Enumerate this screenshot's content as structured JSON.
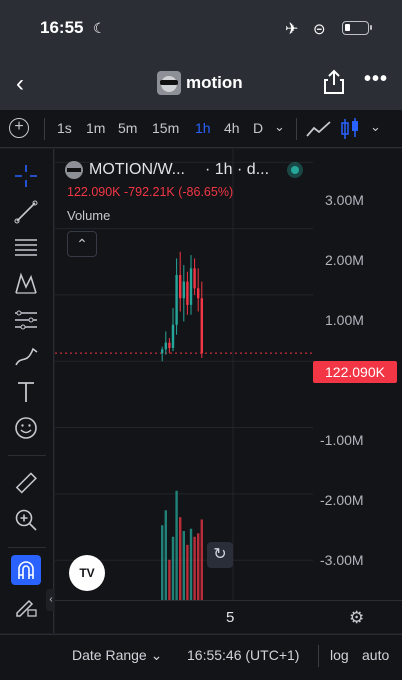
{
  "status": {
    "time": "16:55"
  },
  "nav": {
    "title": "motion"
  },
  "intervals": [
    "1s",
    "1m",
    "5m",
    "15m",
    "1h",
    "4h",
    "D"
  ],
  "active_interval": "1h",
  "legend": {
    "symbol": "MOTION/W...",
    "timeframe": "· 1h · d...",
    "price": "122.090K",
    "change": "-792.21K",
    "change_pct": "(-86.65%)",
    "volume_label": "Volume"
  },
  "price_axis": [
    "3.00M",
    "2.00M",
    "1.00M",
    "-1.00M",
    "-2.00M",
    "-3.00M"
  ],
  "price_tag": "122.090K",
  "time_axis": [
    "5"
  ],
  "bottom": {
    "date_range": "Date Range",
    "clock": "16:55:46 (UTC+1)",
    "log": "log",
    "auto": "auto"
  },
  "colors": {
    "up": "#26a69a",
    "down": "#f23645",
    "accent": "#2962ff",
    "bg": "#131417"
  },
  "chart_data": {
    "type": "bar",
    "y_range_millions": [
      -3.6,
      3.2
    ],
    "last_price_millions": 0.122,
    "candles": [
      {
        "o": 0.12,
        "h": 0.22,
        "l": 0.0,
        "c": 0.18
      },
      {
        "o": 0.18,
        "h": 0.45,
        "l": 0.1,
        "c": 0.28
      },
      {
        "o": 0.28,
        "h": 0.35,
        "l": 0.12,
        "c": 0.2
      },
      {
        "o": 0.2,
        "h": 0.8,
        "l": 0.15,
        "c": 0.55
      },
      {
        "o": 0.55,
        "h": 1.55,
        "l": 0.4,
        "c": 1.3
      },
      {
        "o": 1.3,
        "h": 1.65,
        "l": 0.75,
        "c": 0.95
      },
      {
        "o": 0.95,
        "h": 1.45,
        "l": 0.6,
        "c": 1.2
      },
      {
        "o": 1.2,
        "h": 1.35,
        "l": 0.7,
        "c": 0.85
      },
      {
        "o": 0.85,
        "h": 1.6,
        "l": 0.7,
        "c": 1.4
      },
      {
        "o": 1.4,
        "h": 1.55,
        "l": 1.0,
        "c": 1.1
      },
      {
        "o": 1.1,
        "h": 1.4,
        "l": 0.75,
        "c": 0.95
      },
      {
        "o": 0.95,
        "h": 1.2,
        "l": 0.05,
        "c": 0.12
      }
    ],
    "volume": [
      0.65,
      0.78,
      0.35,
      0.55,
      0.95,
      0.72,
      0.6,
      0.48,
      0.62,
      0.55,
      0.58,
      0.7
    ]
  }
}
